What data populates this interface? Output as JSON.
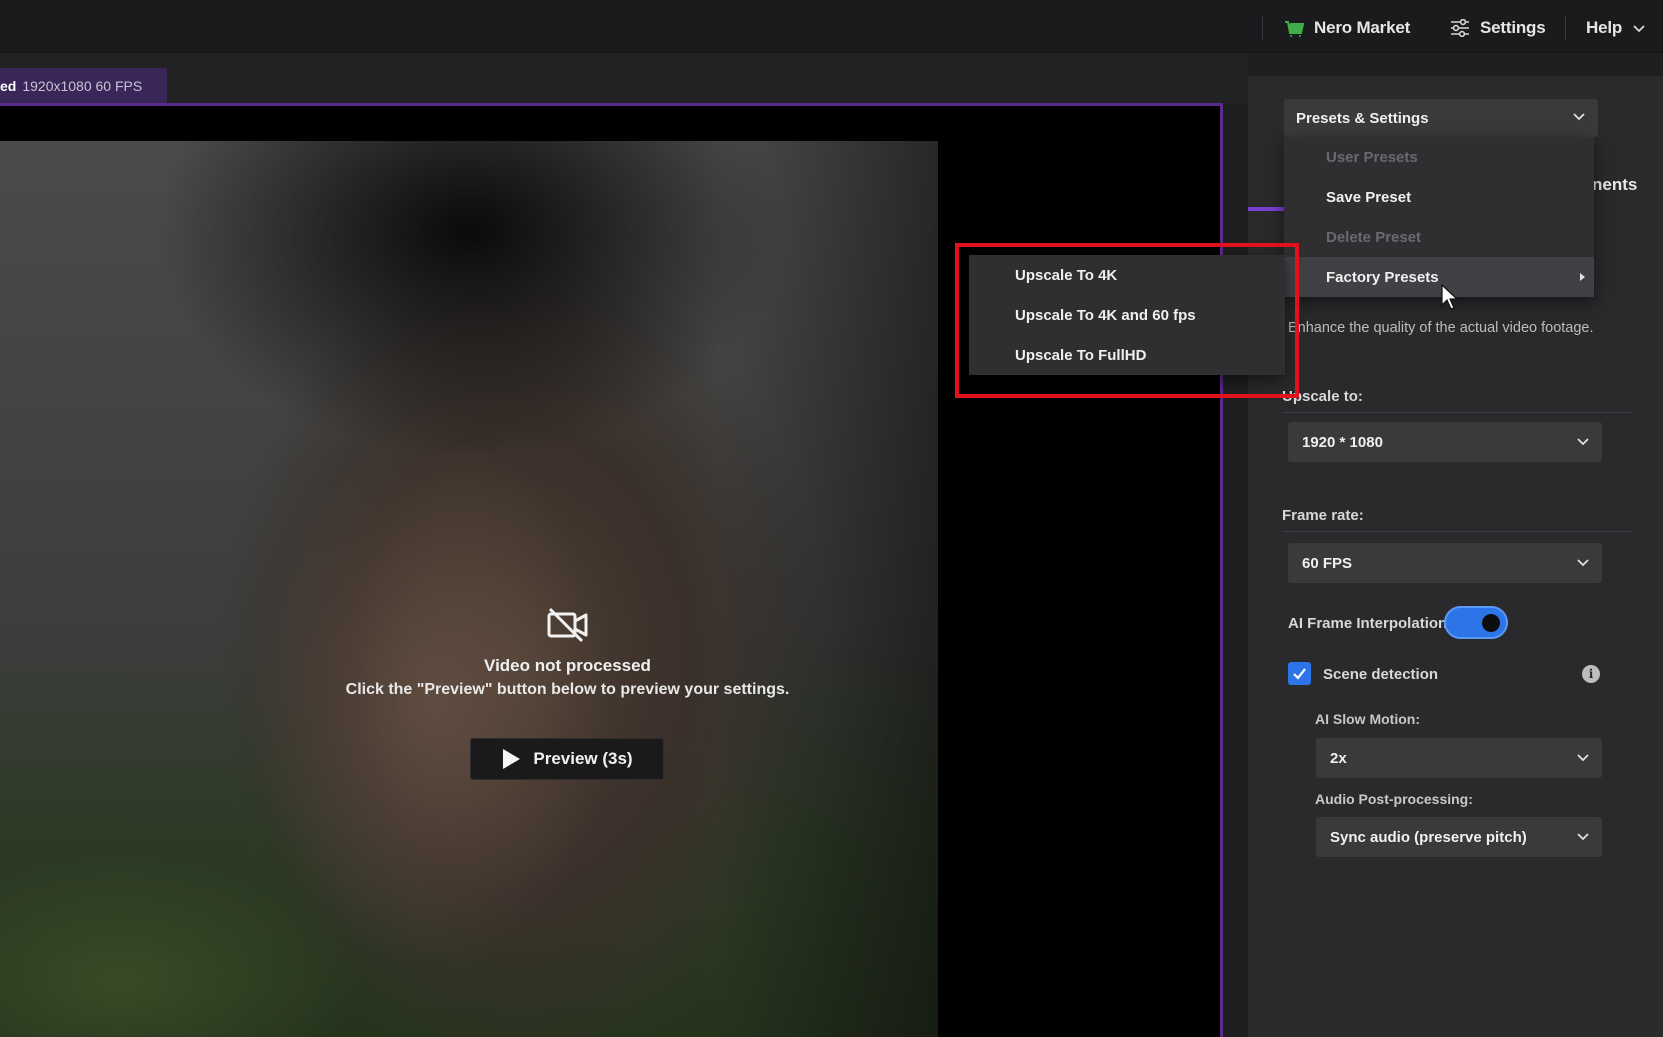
{
  "topbar": {
    "market_label": "Nero Market",
    "settings_label": "Settings",
    "help_label": "Help"
  },
  "tab": {
    "name": "ed",
    "info": "1920x1080 60 FPS"
  },
  "viewer": {
    "message_title": "Video not processed",
    "message_sub": "Click the \"Preview\" button below to preview your settings.",
    "preview_label": "Preview (3s)"
  },
  "presets": {
    "label": "Presets & Settings",
    "menu": {
      "user_presets": "User Presets",
      "save_preset": "Save Preset",
      "delete_preset": "Delete Preset",
      "factory_presets": "Factory Presets"
    },
    "factory_submenu": [
      "Upscale To 4K",
      "Upscale To 4K and 60 fps",
      "Upscale To FullHD"
    ]
  },
  "panel": {
    "tab_fragment": "nents",
    "description": "Enhance the quality of the actual video footage.",
    "upscale_label": "Upscale to:",
    "upscale_value": "1920 * 1080",
    "framerate_label": "Frame rate:",
    "framerate_value": "60 FPS",
    "interp_label": "AI Frame Interpolation",
    "interp_on": true,
    "scene_label": "Scene detection",
    "scene_checked": true,
    "slowmo_label": "AI Slow Motion:",
    "slowmo_value": "2x",
    "audio_label": "Audio Post-processing:",
    "audio_value": "Sync audio (preserve pitch)"
  },
  "colors": {
    "accent": "#7b3fd1",
    "toggle": "#2c74e8",
    "highlight": "#e0121c"
  }
}
